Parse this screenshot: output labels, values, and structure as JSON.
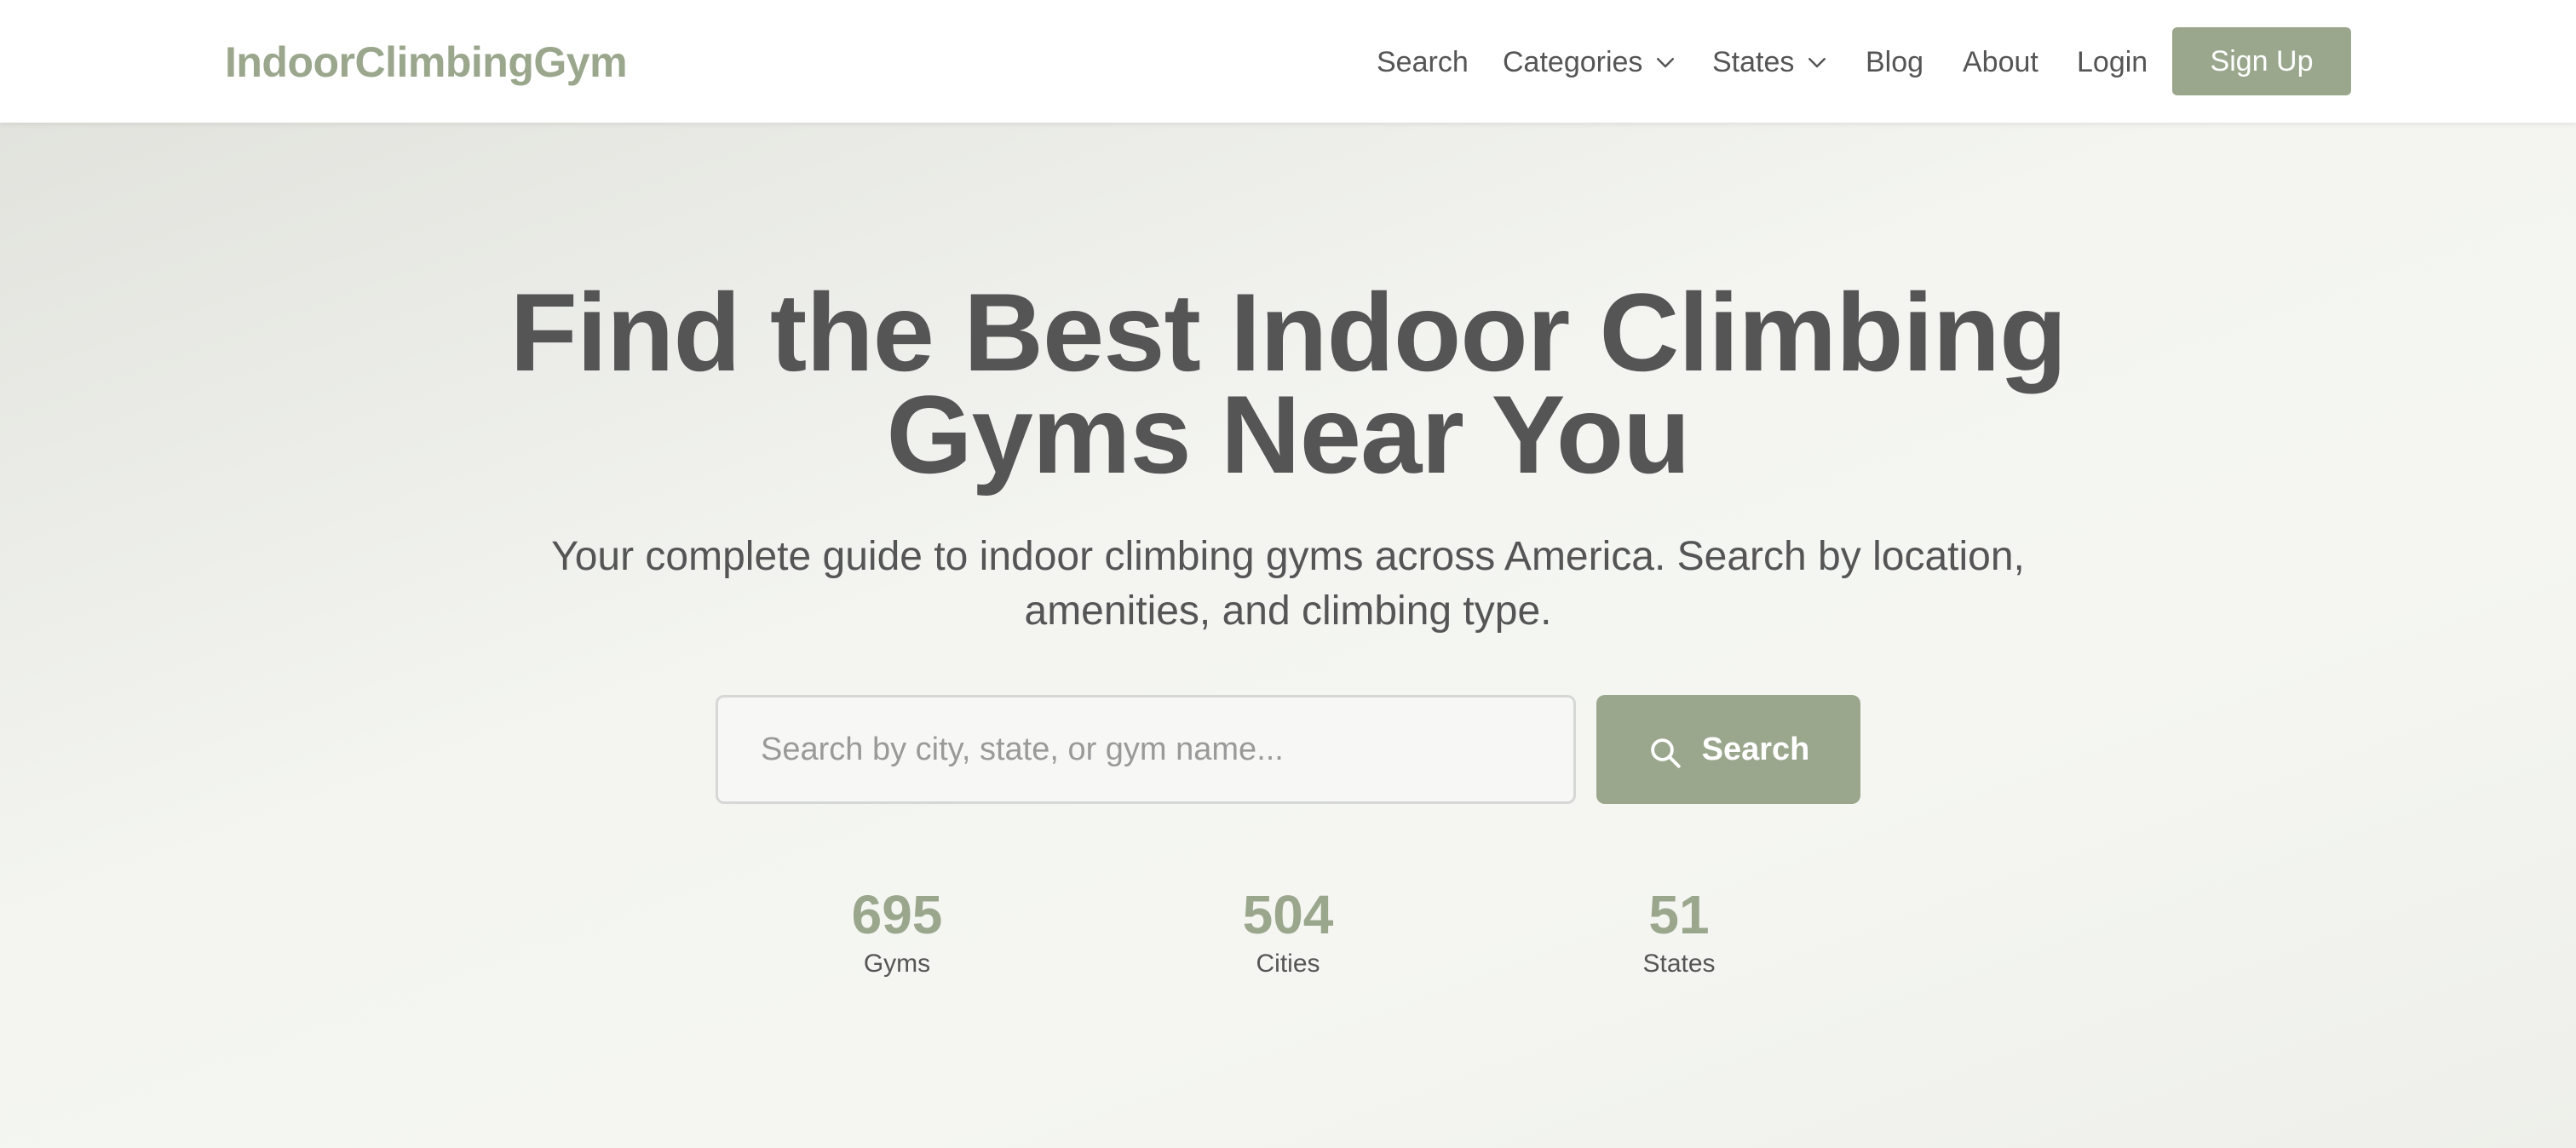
{
  "header": {
    "logo": "IndoorClimbingGym",
    "nav": {
      "search": "Search",
      "categories": "Categories",
      "states": "States",
      "blog": "Blog",
      "about": "About",
      "login": "Login"
    },
    "signup": "Sign Up"
  },
  "hero": {
    "title_line1": "Find the Best Indoor Climbing",
    "title_line2": "Gyms Near You",
    "subtitle_line1": "Your complete guide to indoor climbing gyms across America. Search by location,",
    "subtitle_line2": "amenities, and climbing type.",
    "search": {
      "placeholder": "Search by city, state, or gym name...",
      "value": "",
      "button_label": "Search",
      "button_icon": "search-icon"
    }
  },
  "stats": [
    {
      "value": "695",
      "label": "Gyms"
    },
    {
      "value": "504",
      "label": "Cities"
    },
    {
      "value": "51",
      "label": "States"
    }
  ],
  "colors": {
    "accent": "#9aa78d",
    "text": "#555555",
    "header_bg": "#ffffff"
  }
}
